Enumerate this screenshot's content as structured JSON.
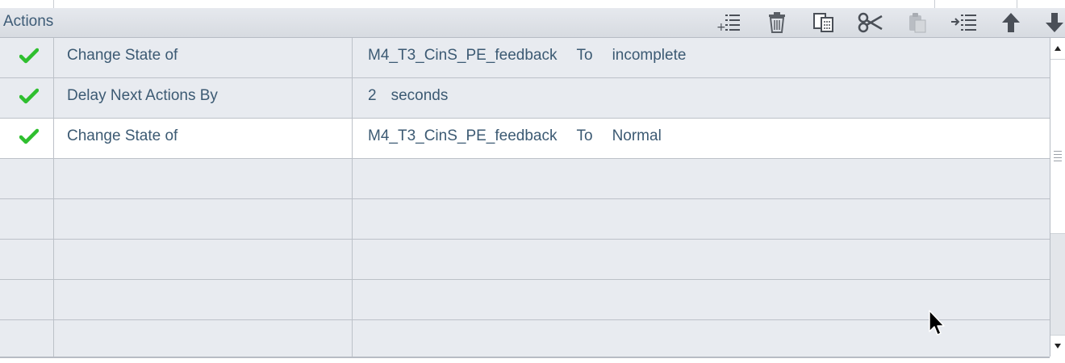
{
  "panel": {
    "title": "Actions",
    "toolbar": [
      {
        "name": "add-action-icon"
      },
      {
        "name": "delete-icon"
      },
      {
        "name": "copy-icon"
      },
      {
        "name": "cut-icon"
      },
      {
        "name": "paste-icon"
      },
      {
        "name": "insert-action-icon"
      },
      {
        "name": "move-up-icon"
      },
      {
        "name": "move-down-icon"
      }
    ]
  },
  "colors": {
    "text": "#3c5a73",
    "check": "#2fbf2f",
    "row_bg": "#e8ebf0",
    "selected_bg": "#ffffff"
  },
  "rows": [
    {
      "enabled": true,
      "action": "Change State of",
      "target": "M4_T3_CinS_PE_feedback",
      "connector": "To",
      "value": "incomplete"
    },
    {
      "enabled": true,
      "action": "Delay Next Actions By",
      "amount": "2",
      "unit": "seconds"
    },
    {
      "enabled": true,
      "action": "Change State of",
      "target": "M4_T3_CinS_PE_feedback",
      "connector": "To",
      "value": "Normal",
      "selected": true
    }
  ]
}
